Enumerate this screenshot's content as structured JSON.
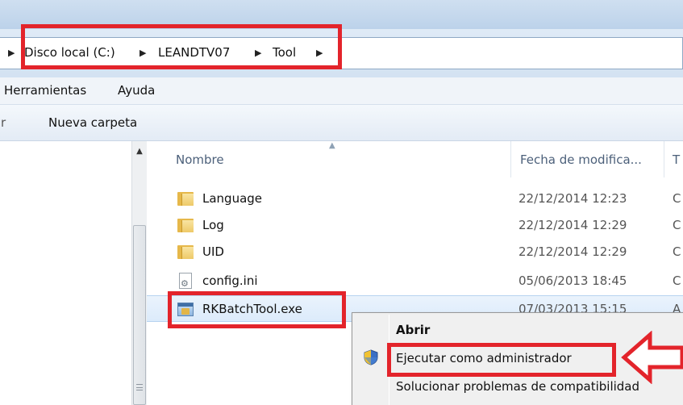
{
  "address_bar": {
    "crumbs": [
      "Disco local (C:)",
      "LEANDTV07",
      "Tool"
    ],
    "separator": "▶"
  },
  "menu_bar": {
    "items": [
      "Herramientas",
      "Ayuda"
    ]
  },
  "command_bar": {
    "new_folder_label": "Nueva carpeta"
  },
  "file_list": {
    "columns": {
      "name": "Nombre",
      "date": "Fecha de modifica...",
      "type": "T"
    },
    "rows": [
      {
        "name": "Language",
        "date": "22/12/2014 12:23",
        "type": "C",
        "icon": "folder-icon"
      },
      {
        "name": "Log",
        "date": "22/12/2014 12:29",
        "type": "C",
        "icon": "folder-icon"
      },
      {
        "name": "UID",
        "date": "22/12/2014 12:29",
        "type": "C",
        "icon": "folder-icon"
      },
      {
        "name": "config.ini",
        "date": "05/06/2013 18:45",
        "type": "C",
        "icon": "config-file-icon"
      },
      {
        "name": "RKBatchTool.exe",
        "date": "07/03/2013 15:15",
        "type": "A",
        "icon": "exe-icon"
      }
    ]
  },
  "context_menu": {
    "open": "Abrir",
    "run_as_admin": "Ejecutar como administrador",
    "troubleshoot": "Solucionar problemas de compatibilidad",
    "icons": [
      "uac-shield-icon"
    ]
  },
  "annotations": {
    "highlight_color": "#e3242b"
  }
}
